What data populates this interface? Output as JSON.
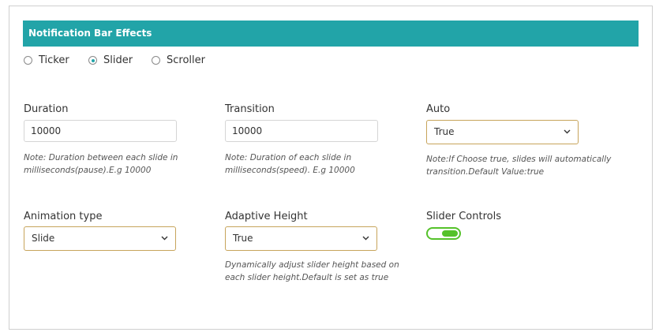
{
  "section": {
    "title": "Notification Bar Effects",
    "accent_color": "#22a4a8"
  },
  "effect_options": [
    {
      "label": "Ticker",
      "selected": false
    },
    {
      "label": "Slider",
      "selected": true
    },
    {
      "label": "Scroller",
      "selected": false
    }
  ],
  "duration": {
    "label": "Duration",
    "value": "10000",
    "note": "Note: Duration between each slide in milliseconds(pause).E.g 10000"
  },
  "transition": {
    "label": "Transition",
    "value": "10000",
    "note": "Note: Duration of each slide in milliseconds(speed). E.g 10000"
  },
  "auto": {
    "label": "Auto",
    "selected": "True",
    "note": "Note:If Choose true, slides will automatically transition.Default Value:true"
  },
  "animation_type": {
    "label": "Animation type",
    "selected": "Slide"
  },
  "adaptive_height": {
    "label": "Adaptive Height",
    "selected": "True",
    "note": "Dynamically adjust slider height based on each slider height.Default is set as true"
  },
  "slider_controls": {
    "label": "Slider Controls",
    "enabled": true,
    "toggle_color": "#55c22a"
  }
}
